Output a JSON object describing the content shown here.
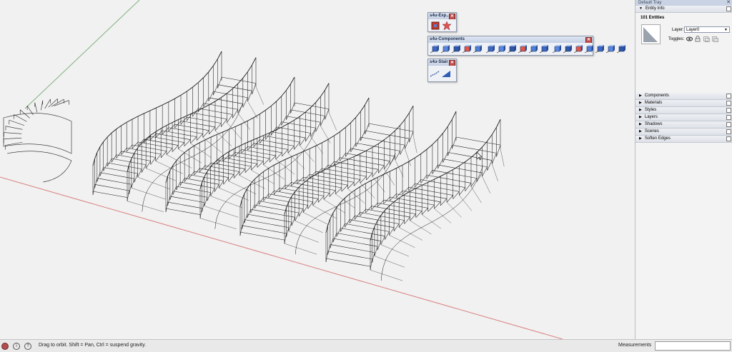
{
  "floating_toolbars": {
    "explore": {
      "title": "s4u-Exp...",
      "buttons": [
        "explode-icon",
        "burst-icon"
      ]
    },
    "components": {
      "title": "s4u-Components",
      "buttons": [
        "comp-1-icon",
        "comp-2-icon",
        "comp-3-icon",
        "comp-4-icon",
        "comp-5-icon",
        "comp-6-icon",
        "comp-7-icon",
        "comp-8-icon",
        "comp-9-icon",
        "comp-10-icon",
        "comp-11-icon",
        "comp-12-icon",
        "comp-13-icon",
        "comp-14-icon",
        "comp-15-icon",
        "comp-16-icon",
        "comp-17-icon",
        "comp-18-icon"
      ]
    },
    "stair": {
      "title": "s4u-Stair",
      "buttons": [
        "stair-line-icon",
        "stair-ramp-icon"
      ]
    }
  },
  "tray": {
    "title": "Default Tray",
    "entity_info": {
      "header": "Entity Info",
      "count_label": "101 Entities",
      "layer_label": "Layer:",
      "layer_value": "Layer0",
      "toggles_label": "Toggles:"
    },
    "sections": [
      "Components",
      "Materials",
      "Styles",
      "Layers",
      "Shadows",
      "Scenes",
      "Soften Edges"
    ]
  },
  "statusbar": {
    "hint": "Drag to orbit. Shift = Pan, Ctrl = suspend gravity.",
    "measurements_label": "Measurements"
  },
  "colors": {
    "red_axis": "#d98080",
    "green_axis": "#7fb07f",
    "accent_blue": "#3a62b5"
  }
}
